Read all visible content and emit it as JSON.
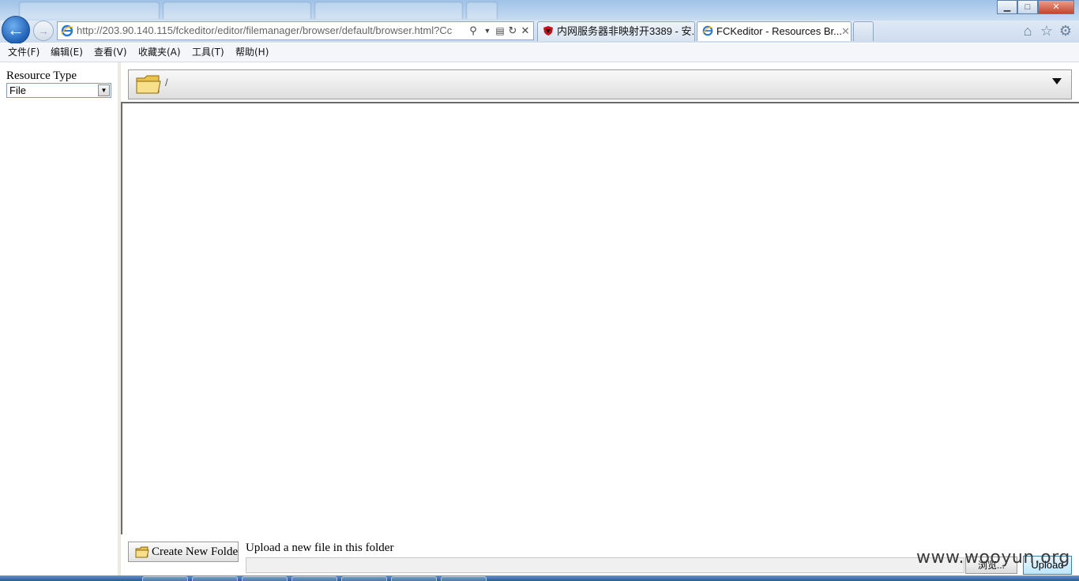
{
  "window": {
    "background_tabs": [
      "",
      "",
      "",
      ""
    ],
    "controls": {
      "minimize": "▁",
      "maximize": "□",
      "close": "✕"
    }
  },
  "navbar": {
    "address": "http://203.90.140.115/fckeditor/editor/filemanager/browser/default/browser.html?Cc",
    "tabs": [
      {
        "label": "内网服务器非映射开3389 - 安...",
        "active": false
      },
      {
        "label": "FCKeditor - Resources Br...",
        "active": true
      }
    ]
  },
  "menubar": {
    "items": [
      "文件(F)",
      "编辑(E)",
      "查看(V)",
      "收藏夹(A)",
      "工具(T)",
      "帮助(H)"
    ]
  },
  "left_frame": {
    "resource_type_label": "Resource Type",
    "resource_type_value": "File"
  },
  "folder_bar": {
    "path": "/"
  },
  "bottom": {
    "create_folder_label": "Create New Folder",
    "upload_label": "Upload a new file in this folder",
    "browse_label": "浏览...",
    "upload_button": "Upload"
  },
  "watermark": "www.wooyun.org",
  "colors": {
    "accent": "#1f5fb5",
    "folder_yellow": "#f5d66b"
  }
}
